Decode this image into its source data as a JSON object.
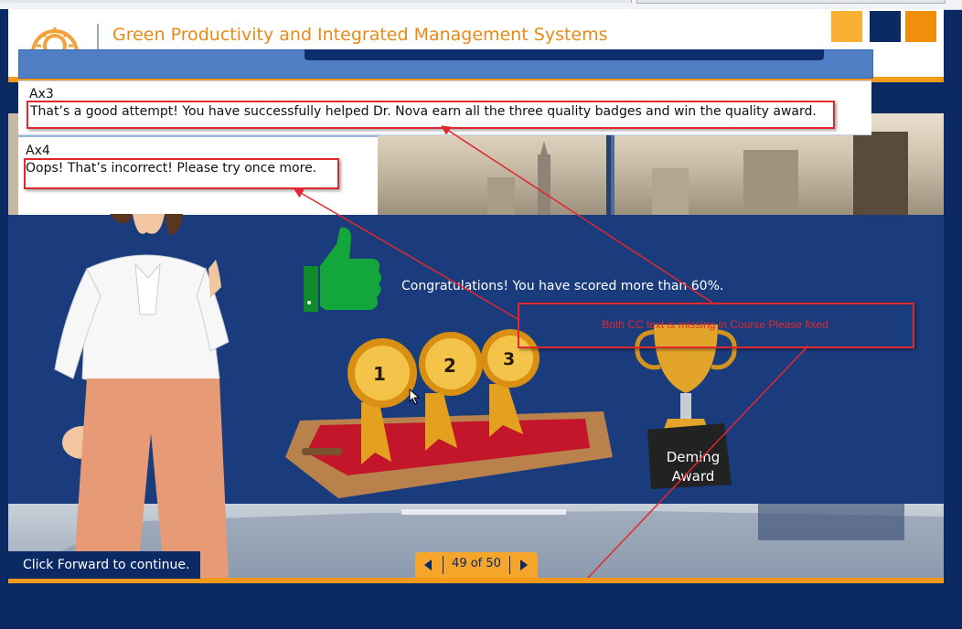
{
  "header": {
    "course_title": "Green Productivity and Integrated Management Systems",
    "colors": {
      "orange_light": "#fbb031",
      "navy": "#0b2a63",
      "orange": "#f18f0c"
    }
  },
  "captions": {
    "ax3": {
      "label": "Ax3",
      "text": "That’s a good attempt! You have successfully  helped Dr. Nova earn all the three quality badges and win the quality award."
    },
    "ax4": {
      "label": "Ax4",
      "text": "Oops! That’s incorrect! Please try once more."
    }
  },
  "slide": {
    "congrats": "Congratulations! You have scored more than 60%.",
    "badges": [
      "1",
      "2",
      "3"
    ],
    "award": {
      "line1": "Deming",
      "line2": "Award"
    }
  },
  "review_note": {
    "text": "Both CC text is missing in Course Please fixed",
    "color": "#e0282e"
  },
  "footer": {
    "instruction": "Click Forward to continue.",
    "page_indicator": "49 of 50",
    "prev_icon": "chevron-left-icon",
    "next_icon": "chevron-right-icon"
  }
}
